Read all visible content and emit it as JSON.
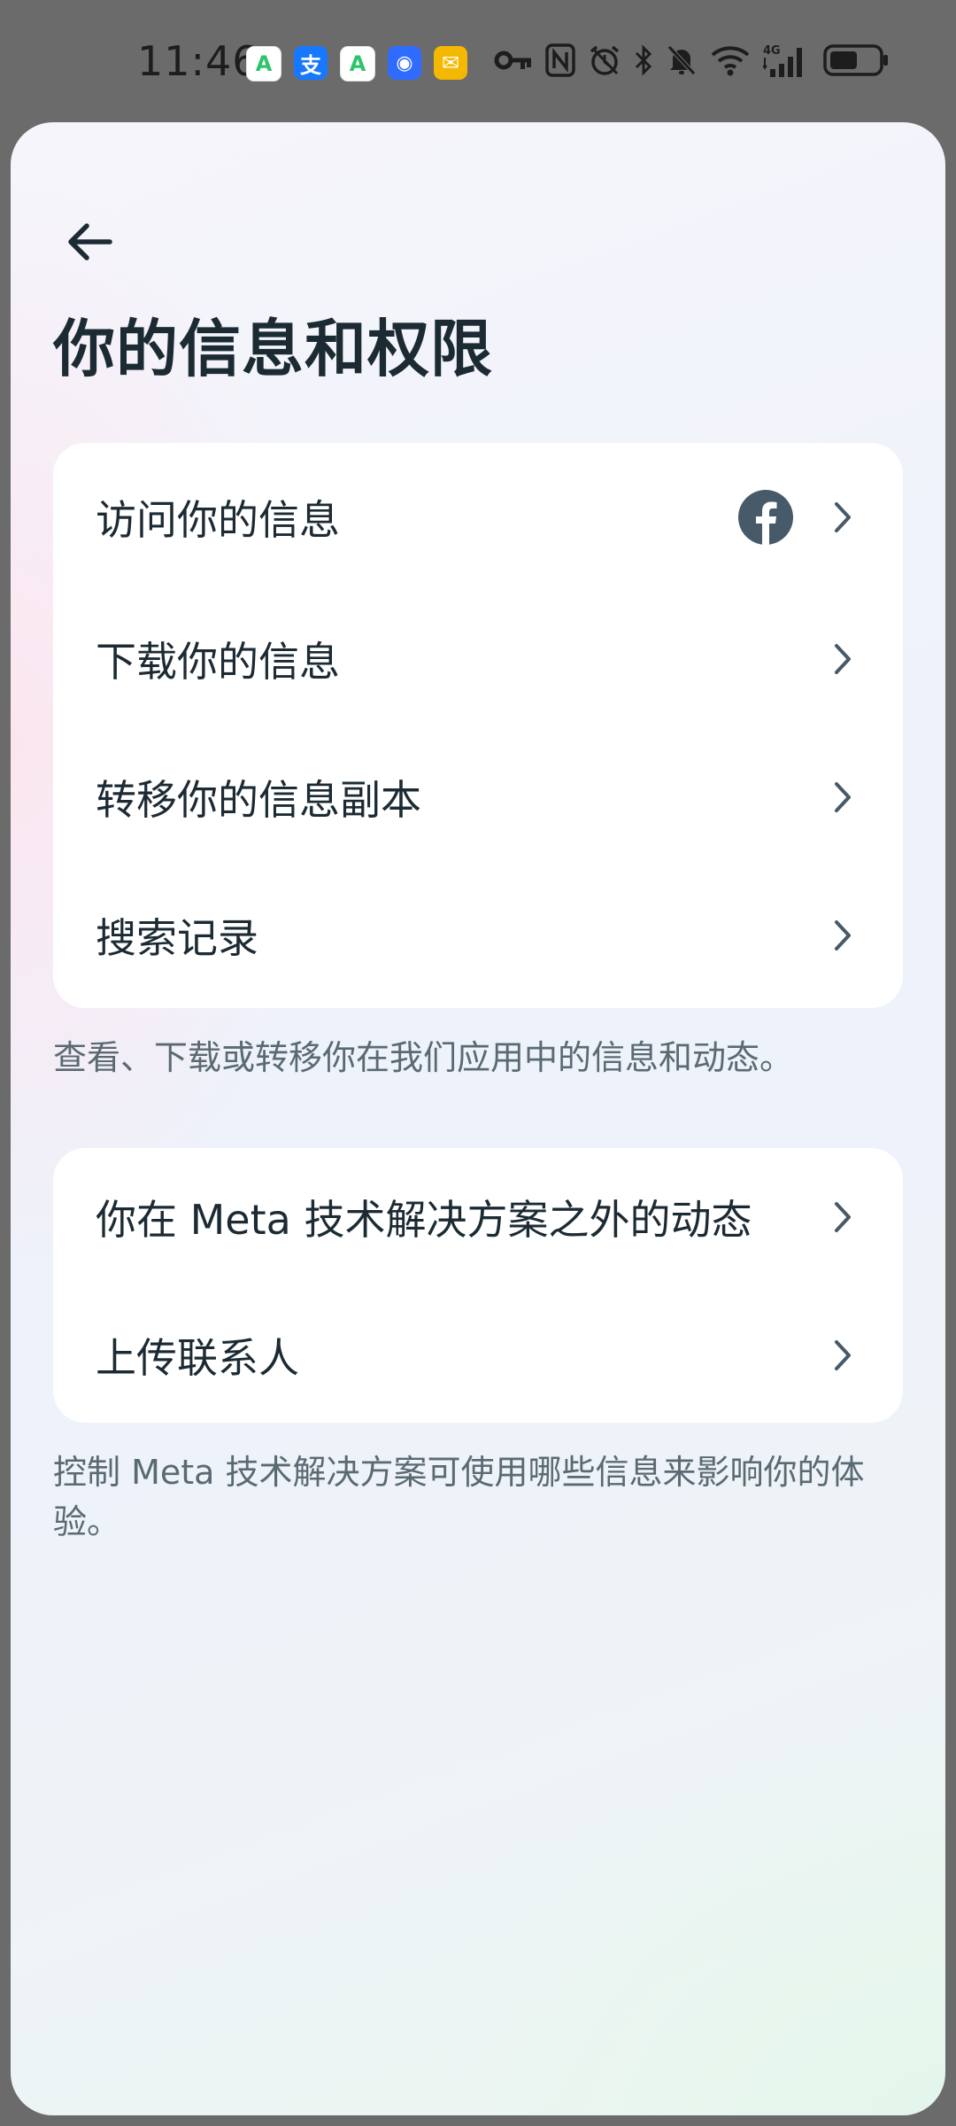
{
  "status_bar": {
    "time": "11:46",
    "app_icons": [
      {
        "name": "app-store-icon",
        "glyph": "A",
        "color": "#2ec46b"
      },
      {
        "name": "alipay-icon",
        "glyph": "支",
        "color": "#1677ff"
      },
      {
        "name": "app-store-icon",
        "glyph": "A",
        "color": "#2ec46b"
      },
      {
        "name": "shield-app-icon",
        "glyph": "◉",
        "color": "#2f6bff"
      },
      {
        "name": "mail-icon",
        "glyph": "✉",
        "color": "#f5b800"
      }
    ],
    "network": "4G"
  },
  "header": {
    "back_icon": "back-arrow-icon",
    "title": "你的信息和权限"
  },
  "section_1": {
    "items": [
      {
        "label": "访问你的信息",
        "has_facebook_icon": true
      },
      {
        "label": "下载你的信息"
      },
      {
        "label": "转移你的信息副本"
      },
      {
        "label": "搜索记录"
      }
    ],
    "description": "查看、下载或转移你在我们应用中的信息和动态。"
  },
  "section_2": {
    "items": [
      {
        "label": "你在 Meta 技术解决方案之外的动态"
      },
      {
        "label": "上传联系人"
      }
    ],
    "description": "控制 Meta 技术解决方案可使用哪些信息来影响你的体验。"
  },
  "colors": {
    "text_primary": "#1c2b33",
    "text_secondary": "#5a6a73",
    "chevron": "#465a69",
    "facebook_icon": "#465a69"
  }
}
